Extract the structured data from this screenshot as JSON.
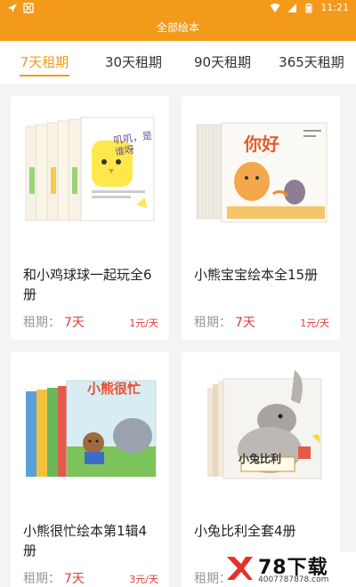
{
  "status_bar": {
    "time": "11:21",
    "icons": [
      "navigation-icon",
      "app-notification-icon",
      "wifi-icon",
      "signal-icon",
      "battery-icon"
    ]
  },
  "header": {
    "title": "全部绘本"
  },
  "tabs": [
    {
      "label": "7天租期",
      "active": true
    },
    {
      "label": "30天租期",
      "active": false
    },
    {
      "label": "90天租期",
      "active": false
    },
    {
      "label": "365天租期",
      "active": false
    }
  ],
  "books": [
    {
      "title": "和小鸡球球一起玩全6册",
      "period_label": "租期：",
      "period_value": "7天",
      "price": "1元/天",
      "cover_text": "叽叽，是谁呀"
    },
    {
      "title": "小熊宝宝绘本全15册",
      "period_label": "租期：",
      "period_value": "7天",
      "price": "1元/天",
      "cover_text": "你好"
    },
    {
      "title": "小熊很忙绘本第1辑4册",
      "period_label": "租期：",
      "period_value": "7天",
      "price": "3元/天",
      "cover_text": "小熊很忙"
    },
    {
      "title": "小兔比利全套4册",
      "period_label": "租期：",
      "period_value": "7天",
      "price": "",
      "cover_text": "小兔比利"
    }
  ],
  "watermark": {
    "main": "78下载",
    "sub": "4007787878.com"
  },
  "colors": {
    "accent": "#f39a1a",
    "price": "#e53935"
  }
}
